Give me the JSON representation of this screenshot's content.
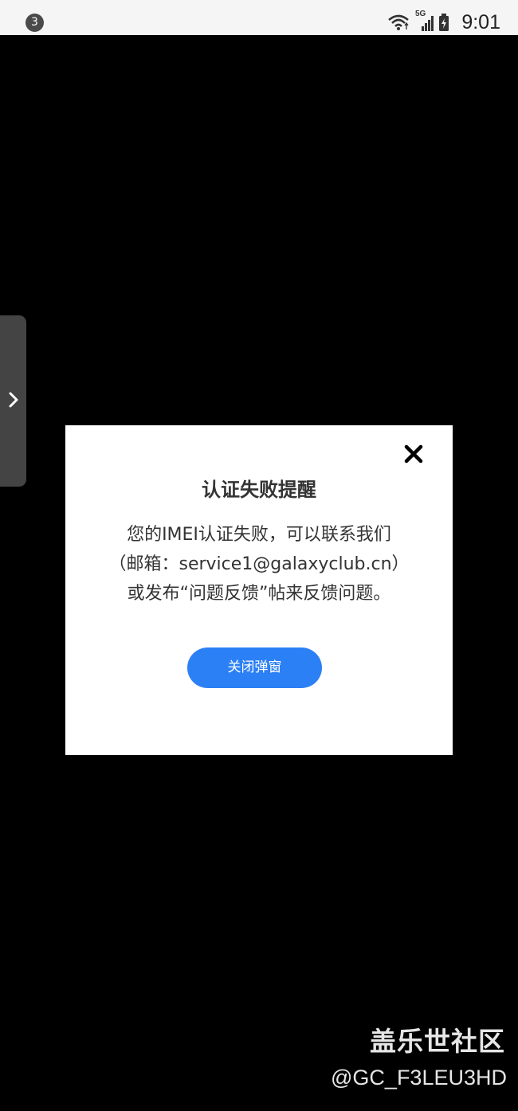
{
  "status_bar": {
    "notification_count": "3",
    "network_label": "5G",
    "time": "9:01",
    "icons": [
      "wifi-icon",
      "signal-5g-icon",
      "battery-charging-icon"
    ]
  },
  "side_panel": {
    "handle_icon": "chevron-right-icon"
  },
  "dialog": {
    "title": "认证失败提醒",
    "message_lines": [
      "您的IMEI认证失败，可以联系我们",
      "（邮箱：service1@galaxyclub.cn）",
      "或发布“问题反馈”帖来反馈问题。"
    ],
    "close_icon": "close-icon",
    "button_label": "关闭弹窗",
    "button_color": "#2c80f5"
  },
  "watermark": {
    "brand": "盖乐世社区",
    "user_id": "@GC_F3LEU3HD"
  }
}
